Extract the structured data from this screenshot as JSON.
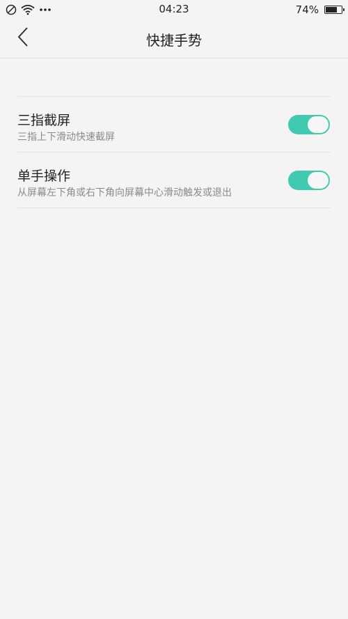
{
  "status_bar": {
    "time": "04:23",
    "battery_percent_text": "74%",
    "battery_level": 0.74,
    "icons": [
      "no-disturb-icon",
      "wifi-icon",
      "more-dots-icon",
      "battery-icon"
    ]
  },
  "nav": {
    "title": "快捷手势",
    "back_icon": "chevron-left-icon"
  },
  "settings": [
    {
      "title": "三指截屏",
      "description": "三指上下滑动快速截屏",
      "enabled": true
    },
    {
      "title": "单手操作",
      "description": "从屏幕左下角或右下角向屏幕中心滑动触发或退出",
      "enabled": true
    }
  ],
  "colors": {
    "toggle_on": "#40cbb1",
    "background": "#f4f4f4"
  }
}
